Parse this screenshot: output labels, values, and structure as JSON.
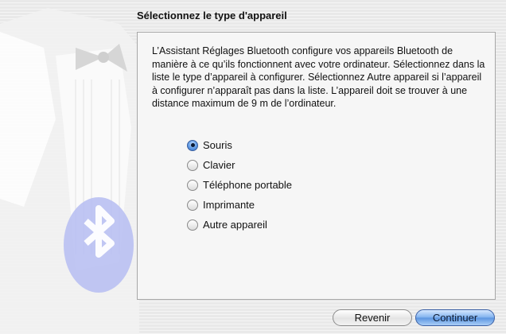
{
  "page": {
    "title": "Sélectionnez le type d'appareil"
  },
  "panel": {
    "description": "L’Assistant Réglages Bluetooth configure vos appareils Bluetooth de manière à ce qu’ils fonctionnent avec votre ordinateur. Sélectionnez dans la liste le type d’appareil à configurer. Sélectionnez Autre appareil si l’appareil à configurer n’apparaît pas dans la liste. L’appareil doit se trouver à une distance maximum de 9 m de l’ordinateur.",
    "options": [
      {
        "label": "Souris",
        "selected": true
      },
      {
        "label": "Clavier",
        "selected": false
      },
      {
        "label": "Téléphone portable",
        "selected": false
      },
      {
        "label": "Imprimante",
        "selected": false
      },
      {
        "label": "Autre appareil",
        "selected": false
      }
    ]
  },
  "buttons": {
    "back_label": "Revenir",
    "continue_label": "Continuer"
  },
  "decor": {
    "illustration": "tuxedo-bluetooth-icon",
    "accent_color": "#5a94e0"
  }
}
